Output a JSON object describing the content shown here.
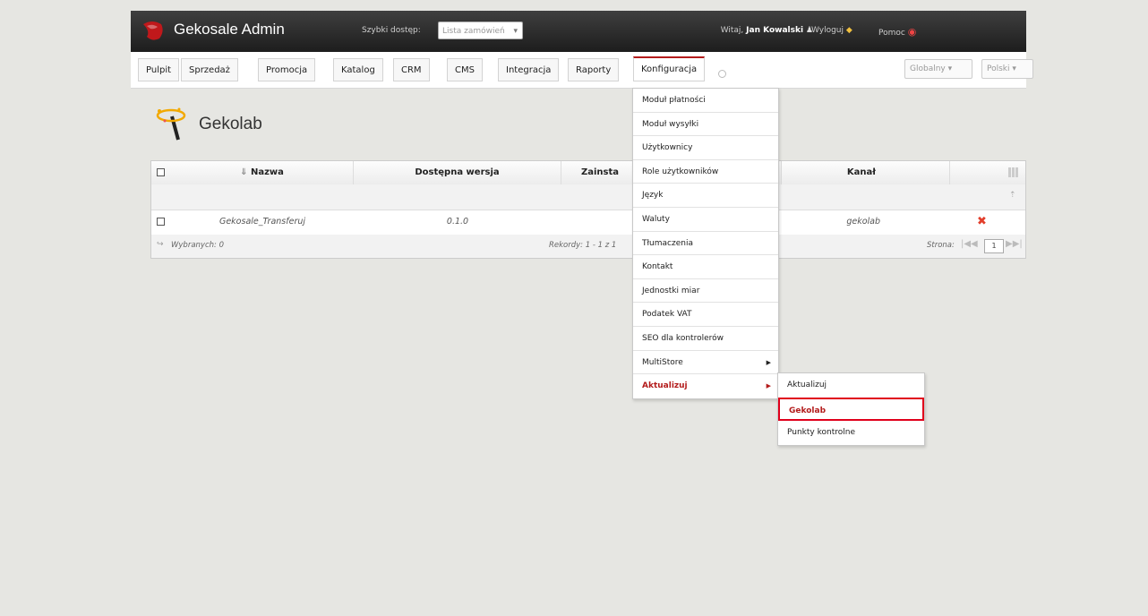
{
  "header": {
    "title": "Gekosale Admin",
    "quick_access_label": "Szybki dostęp:",
    "quick_access_value": "Lista zamówień",
    "welcome_prefix": "Witaj,",
    "user_name": "Jan Kowalski",
    "logout": "Wyloguj",
    "help": "Pomoc"
  },
  "main_menu": {
    "items": [
      "Pulpit",
      "Sprzedaż",
      "Promocja",
      "Katalog",
      "CRM",
      "CMS",
      "Integracja",
      "Raporty",
      "Konfiguracja"
    ],
    "active": "Konfiguracja",
    "scope_select": "Globalny",
    "language_select": "Polski"
  },
  "page": {
    "title": "Gekolab"
  },
  "grid": {
    "columns": [
      "Nazwa",
      "Dostępna wersja",
      "Zainsta",
      "Kanał"
    ],
    "sort_indicator": "⇓",
    "rows": [
      {
        "name": "Gekosale_Transferuj",
        "version": "0.1.0",
        "channel": "gekolab"
      }
    ],
    "footer": {
      "selected": "Wybranych: 0",
      "records": "Rekordy: 1 - 1 z 1",
      "page_label": "Strona:",
      "page_value": "1"
    }
  },
  "dropdown": {
    "items": [
      "Moduł płatności",
      "Moduł wysyłki",
      "Użytkownicy",
      "Role użytkowników",
      "Język",
      "Waluty",
      "Tłumaczenia",
      "Kontakt",
      "Jednostki miar",
      "Podatek VAT",
      "SEO dla kontrolerów",
      "MultiStore",
      "Aktualizuj"
    ],
    "active": "Aktualizuj"
  },
  "submenu": {
    "items": [
      "Aktualizuj",
      "Gekolab",
      "Punkty kontrolne"
    ],
    "highlighted": "Gekolab"
  },
  "colors": {
    "accent": "#b31b1b",
    "highlight_border": "#e0001b",
    "topbar": "#2b2b2b"
  }
}
